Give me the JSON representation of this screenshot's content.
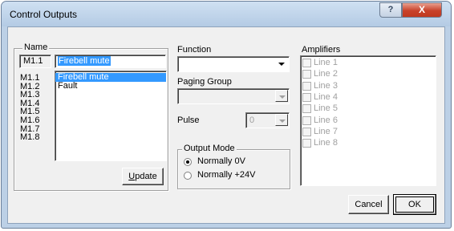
{
  "window": {
    "title": "Control Outputs",
    "help_glyph": "?",
    "close_glyph": "X"
  },
  "name_group": {
    "label": "Name",
    "current_id": "M1.1",
    "current_name": "Firebell mute",
    "ids": [
      "M1.1",
      "M1.2",
      "M1.3",
      "M1.4",
      "M1.5",
      "M1.6",
      "M1.7",
      "M1.8"
    ],
    "names": [
      {
        "text": "Firebell mute",
        "selected": true
      },
      {
        "text": "Fault",
        "selected": false
      }
    ],
    "update_prefix": "U",
    "update_rest": "pdate"
  },
  "function": {
    "label": "Function",
    "value": ""
  },
  "paging_group": {
    "label": "Paging Group",
    "value": ""
  },
  "pulse": {
    "label": "Pulse",
    "value": "0"
  },
  "output_mode": {
    "label": "Output Mode",
    "options": [
      {
        "label": "Normally 0V",
        "checked": true
      },
      {
        "label": "Normally +24V",
        "checked": false
      }
    ]
  },
  "amplifiers": {
    "label": "Amplifiers",
    "lines": [
      "Line 1",
      "Line 2",
      "Line 3",
      "Line 4",
      "Line 5",
      "Line 6",
      "Line 7",
      "Line 8"
    ]
  },
  "buttons": {
    "cancel": "Cancel",
    "ok": "OK"
  }
}
